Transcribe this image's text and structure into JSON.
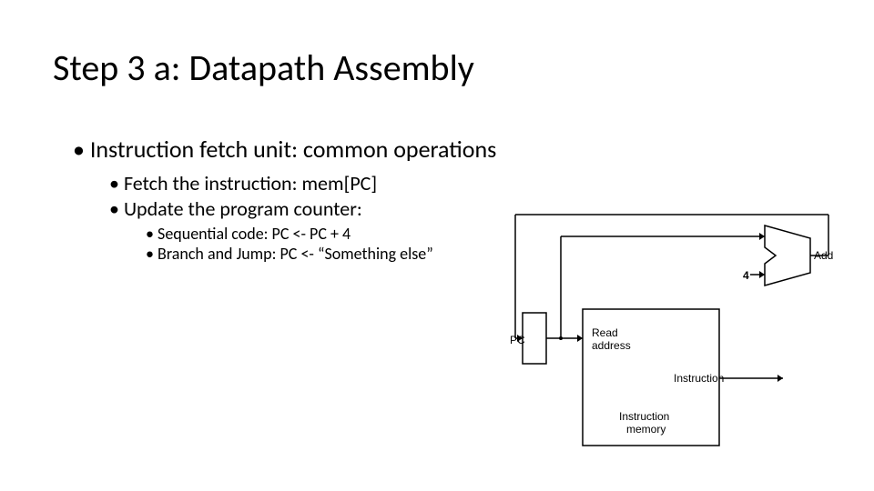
{
  "title": "Step 3 a: Datapath Assembly",
  "bullets": {
    "l1": "Instruction fetch unit: common operations",
    "l2a": "Fetch the instruction: mem[PC]",
    "l2b": "Update the program counter:",
    "l3a": "Sequential code: PC <- PC + 4",
    "l3b": "Branch and Jump:   PC <- “Something else”"
  },
  "diagram": {
    "pc_label": "PC",
    "read_addr": "Read",
    "read_addr2": "address",
    "instr_mem1": "Instruction",
    "instr_mem2": "memory",
    "instr_out": "Instruction",
    "add_label": "Add",
    "four_label": "4"
  }
}
